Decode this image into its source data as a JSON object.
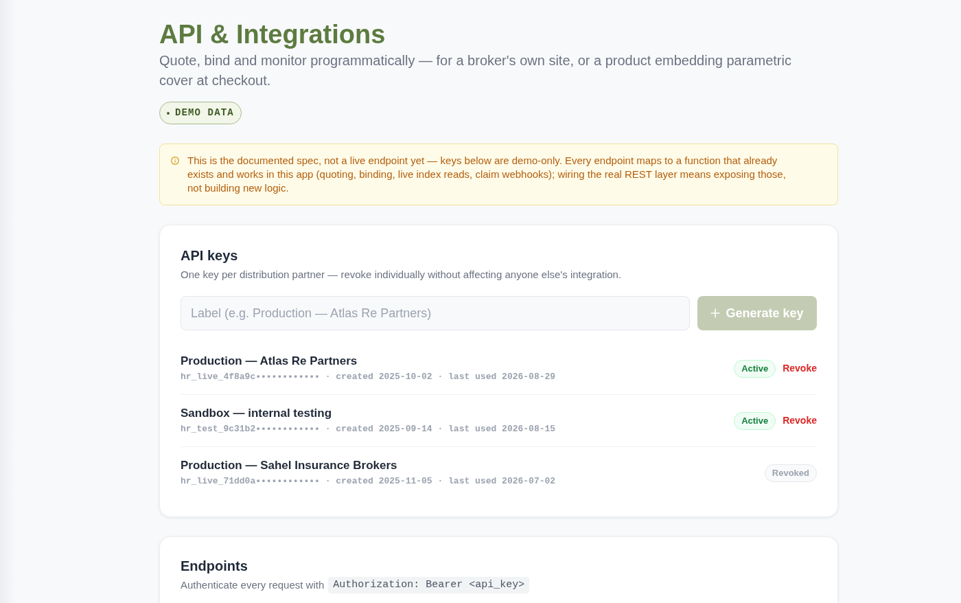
{
  "page": {
    "title": "API & Integrations",
    "subtitle": "Quote, bind and monitor programmatically — for a broker's own site, or a product embedding parametric cover at checkout.",
    "badge": "DEMO DATA"
  },
  "notice": {
    "text": "This is the documented spec, not a live endpoint yet — keys below are demo-only. Every endpoint maps to a function that already exists and works in this app (quoting, binding, live index reads, claim webhooks); wiring the real REST layer means exposing those, not building new logic."
  },
  "api_keys": {
    "title": "API keys",
    "description": "One key per distribution partner — revoke individually without affecting anyone else's integration.",
    "label_field": {
      "placeholder": "Label (e.g. Production — Atlas Re Partners)"
    },
    "generate_button": {
      "label": "Generate key",
      "disabled": true
    },
    "keys": [
      {
        "name": "Production — Atlas Re Partners",
        "meta": "hr_live_4f8a9c•••••••••••• · created 2025-10-02 · last used 2026-08-29",
        "status": {
          "kind": "active",
          "label": "Active"
        },
        "action": "Revoke"
      },
      {
        "name": "Sandbox — internal testing",
        "meta": "hr_test_9c31b2•••••••••••• · created 2025-09-14 · last used 2026-08-15",
        "status": {
          "kind": "active",
          "label": "Active"
        },
        "action": "Revoke"
      },
      {
        "name": "Production — Sahel Insurance Brokers",
        "meta": "hr_live_71dd0a•••••••••••• · created 2025-11-05 · last used 2026-07-02",
        "status": {
          "kind": "revoked",
          "label": "Revoked"
        }
      }
    ]
  },
  "endpoints": {
    "title": "Endpoints",
    "intro": "Authenticate every request with",
    "auth_header": "Authorization: Bearer <api_key>"
  }
}
